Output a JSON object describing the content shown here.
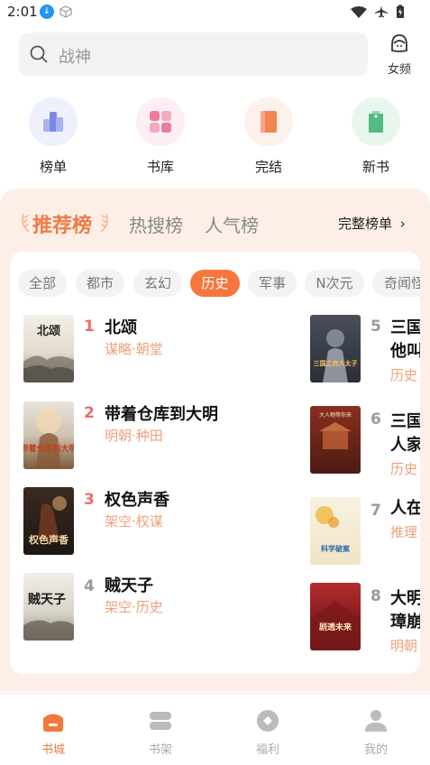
{
  "status_bar": {
    "time": "2:01"
  },
  "search": {
    "placeholder": "战神",
    "female_label": "女频"
  },
  "quick_nav": [
    {
      "label": "榜单",
      "icon": "ranking-icon",
      "bg": "#eef0fb",
      "color": "#7b86e6"
    },
    {
      "label": "书库",
      "icon": "library-icon",
      "bg": "#fdeef2",
      "color": "#ee7a9c"
    },
    {
      "label": "完结",
      "icon": "completed-icon",
      "bg": "#fdf1ec",
      "color": "#f28552"
    },
    {
      "label": "新书",
      "icon": "new-book-icon",
      "bg": "#e8f6ee",
      "color": "#52bb82"
    }
  ],
  "rank": {
    "tabs": [
      "推荐榜",
      "热搜榜",
      "人气榜"
    ],
    "full_list": "完整榜单",
    "chips": [
      "全部",
      "都市",
      "玄幻",
      "历史",
      "军事",
      "N次元",
      "奇闻怪谈"
    ],
    "active_chip": "历史",
    "left_books": [
      {
        "no": "1",
        "title": "北颂",
        "tags": "谋略·朝堂"
      },
      {
        "no": "2",
        "title": "带着仓库到大明",
        "tags": "明朝·种田"
      },
      {
        "no": "3",
        "title": "权色声香",
        "tags": "架空·权谋"
      },
      {
        "no": "4",
        "title": "贼天子",
        "tags": "架空·历史"
      }
    ],
    "right_books": [
      {
        "no": "5",
        "title": "三国",
        "title2": "他叫",
        "tags": "历史"
      },
      {
        "no": "6",
        "title": "三国",
        "title2": "人家",
        "tags": "历史"
      },
      {
        "no": "7",
        "title": "人在",
        "title2": "",
        "tags": "推理"
      },
      {
        "no": "8",
        "title": "大明",
        "title2": "璋崩",
        "tags": "明朝"
      }
    ],
    "rank_colors": {
      "top": "#f06a6a",
      "rest": "#999999"
    },
    "cover_texts": [
      "北颂",
      "带着仓库到大明",
      "权色声香",
      "贼天子",
      "三国之庶人太子",
      "大人物等你来",
      "科学破案",
      "剧透未来"
    ]
  },
  "bottom_tabs": [
    {
      "label": "书城",
      "icon": "bookstore-icon",
      "active": true
    },
    {
      "label": "书架",
      "icon": "bookshelf-icon",
      "active": false
    },
    {
      "label": "福利",
      "icon": "welfare-icon",
      "active": false
    },
    {
      "label": "我的",
      "icon": "profile-icon",
      "active": false
    }
  ],
  "colors": {
    "accent": "#f5773d",
    "panel_bg": "#fdefe8"
  }
}
